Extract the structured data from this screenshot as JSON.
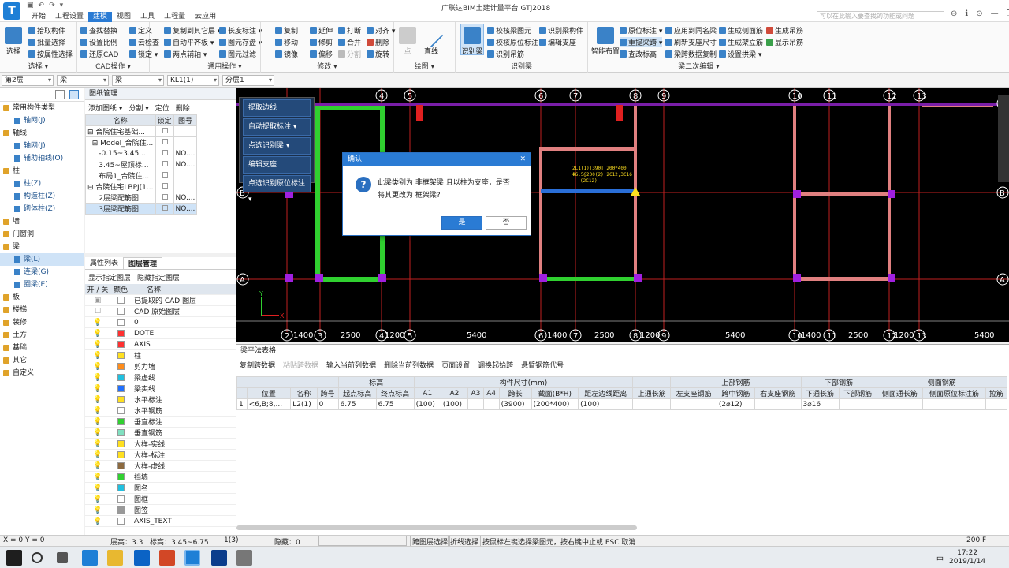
{
  "app": {
    "title": "广联达BIM土建计量平台 GTJ2018",
    "logo": "T",
    "search_placeholder": "可以在此输入要查找的功能或问题",
    "qat": [
      "▣",
      "↶",
      "↷",
      "▾"
    ],
    "win": [
      "⊖",
      "ℹ",
      "⊙",
      "—",
      "❐",
      "✕"
    ]
  },
  "menu_tabs": [
    "开始",
    "工程设置",
    "建模",
    "视图",
    "工具",
    "工程量",
    "云应用"
  ],
  "ribbon": {
    "select": {
      "title": "选择 ▾",
      "big": "选择",
      "items": [
        "拾取构件",
        "批量选择",
        "按属性选择"
      ]
    },
    "cad": {
      "title": "CAD操作 ▾",
      "items": [
        "定义",
        "云检查",
        "锁定 ▾",
        "复制到其它层 ▾",
        "自动平齐板 ▾",
        "两点辅轴 ▾",
        "查找替换",
        "设置比例",
        "还原CAD"
      ]
    },
    "general": {
      "title": "通用操作 ▾",
      "items": [
        "长度标注 ▾",
        "图元存盘 ▾",
        "图元过滤"
      ]
    },
    "modify": {
      "title": "修改 ▾",
      "items": [
        "复制",
        "移动",
        "镜像",
        "延伸",
        "修剪",
        "偏移",
        "打断",
        "合并",
        "分割",
        "对齐 ▾",
        "删除",
        "旋转"
      ]
    },
    "draw": {
      "title": "绘图 ▾",
      "items": [
        "点",
        "直线"
      ]
    },
    "recog": {
      "title": "识别梁",
      "big": "识别梁",
      "items": [
        "校核梁图元",
        "校核原位标注",
        "识别吊筋",
        "识别梁构件",
        "编辑支座"
      ]
    },
    "beam2": {
      "title": "梁二次编辑 ▾",
      "big": "智能布置",
      "items": [
        "原位标注 ▾",
        "重提梁跨 ▾",
        "查改标高",
        "应用到同名梁",
        "刷新支座尺寸",
        "梁跨数据复制",
        "生成侧面筋",
        "生成架立筋",
        "设置拱梁 ▾",
        "生成吊筋",
        "显示吊筋"
      ]
    }
  },
  "filters": [
    "第2层",
    "梁",
    "梁",
    "KL1(1)",
    "分层1"
  ],
  "leftnav": [
    {
      "label": "常用构件类型",
      "type": "cat"
    },
    {
      "label": "轴网(J)",
      "type": "sub"
    },
    {
      "label": "轴线",
      "type": "cat"
    },
    {
      "label": "轴网(J)",
      "type": "sub"
    },
    {
      "label": "辅助轴线(O)",
      "type": "sub"
    },
    {
      "label": "柱",
      "type": "cat"
    },
    {
      "label": "柱(Z)",
      "type": "sub"
    },
    {
      "label": "构造柱(Z)",
      "type": "sub"
    },
    {
      "label": "砌体柱(Z)",
      "type": "sub"
    },
    {
      "label": "墙",
      "type": "cat"
    },
    {
      "label": "门窗洞",
      "type": "cat"
    },
    {
      "label": "梁",
      "type": "cat"
    },
    {
      "label": "梁(L)",
      "type": "sub",
      "sel": true
    },
    {
      "label": "连梁(G)",
      "type": "sub"
    },
    {
      "label": "圈梁(E)",
      "type": "sub"
    },
    {
      "label": "板",
      "type": "cat"
    },
    {
      "label": "楼梯",
      "type": "cat"
    },
    {
      "label": "装修",
      "type": "cat"
    },
    {
      "label": "土方",
      "type": "cat"
    },
    {
      "label": "基础",
      "type": "cat"
    },
    {
      "label": "其它",
      "type": "cat"
    },
    {
      "label": "自定义",
      "type": "cat"
    }
  ],
  "drawing": {
    "title": "图纸管理",
    "tools": [
      "添加图纸 ▾",
      "分割 ▾",
      "定位",
      "删除"
    ],
    "headers": [
      "名称",
      "锁定",
      "图号"
    ],
    "rows": [
      [
        "⊟ 合院住宅基础...",
        "",
        ""
      ],
      [
        "  ⊟ Model_合院住...",
        "",
        ""
      ],
      [
        "     -0.15~3.45...",
        "",
        "NO...."
      ],
      [
        "     3.45~屋顶标...",
        "",
        "NO...."
      ],
      [
        "     布局1_合院住...",
        "",
        ""
      ],
      [
        "⊟ 合院住宅LBPJ(1...",
        "",
        ""
      ],
      [
        "     2层梁配筋图",
        "",
        "NO...."
      ],
      [
        "     3层梁配筋图",
        "",
        "NO...."
      ]
    ]
  },
  "layers": {
    "tabs": [
      "属性列表",
      "图层管理"
    ],
    "tools": [
      "显示指定图层",
      "隐藏指定图层"
    ],
    "headers": [
      "开 / 关",
      "颜色",
      "名称"
    ],
    "rows": [
      {
        "name": "已提取的 CAD 图层",
        "color": "#ffffff",
        "on": "▣"
      },
      {
        "name": "CAD 原始图层",
        "color": "#ffffff",
        "on": "☐"
      },
      {
        "name": "0",
        "color": "#ffffff",
        "on": "💡"
      },
      {
        "name": "DOTE",
        "color": "#ff3030",
        "on": "💡"
      },
      {
        "name": "AXIS",
        "color": "#ff3030",
        "on": "💡"
      },
      {
        "name": "柱",
        "color": "#ffe020",
        "on": "💡"
      },
      {
        "name": "剪力墙",
        "color": "#ff8c1a",
        "on": "💡"
      },
      {
        "name": "梁虚线",
        "color": "#20c0e0",
        "on": "💡"
      },
      {
        "name": "梁实线",
        "color": "#2070ff",
        "on": "💡"
      },
      {
        "name": "水平标注",
        "color": "#ffe020",
        "on": "💡"
      },
      {
        "name": "水平钢筋",
        "color": "#ffffff",
        "on": "💡"
      },
      {
        "name": "垂直标注",
        "color": "#30d030",
        "on": "💡"
      },
      {
        "name": "垂直钢筋",
        "color": "#80e0c0",
        "on": "💡"
      },
      {
        "name": "大样-实线",
        "color": "#ffe020",
        "on": "💡"
      },
      {
        "name": "大样-标注",
        "color": "#ffe020",
        "on": "💡"
      },
      {
        "name": "大样-虚线",
        "color": "#8c6a40",
        "on": "💡"
      },
      {
        "name": "挡墙",
        "color": "#30d030",
        "on": "💡"
      },
      {
        "name": "图名",
        "color": "#20c0e0",
        "on": "💡"
      },
      {
        "name": "图框",
        "color": "#ffffff",
        "on": "💡"
      },
      {
        "name": "图签",
        "color": "#999999",
        "on": "💡"
      },
      {
        "name": "AXIS_TEXT",
        "color": "#ffffff",
        "on": "💡"
      }
    ]
  },
  "canvas": {
    "menu": [
      "提取边线",
      "自动提取标注 ▾",
      "点选识别梁 ▾",
      "编辑支座",
      "点选识别原位标注 ▾"
    ],
    "axes_bottom": [
      "2",
      "3",
      "4",
      "5",
      "6",
      "7",
      "8",
      "9",
      "10",
      "11",
      "12",
      "13"
    ],
    "axes_top": [
      "4",
      "5",
      "6",
      "7",
      "8",
      "9",
      "10",
      "11",
      "12",
      "13"
    ],
    "axes_right": [
      "C",
      "B",
      "A"
    ],
    "axes_left": [
      "B",
      "A"
    ],
    "dims": [
      "1400",
      "2500",
      "1200",
      "5400",
      "1400",
      "2500",
      "1200",
      "5400",
      "1400",
      "2500",
      "1200",
      "5400"
    ],
    "beam_label": [
      "2L1(1)[390] 200*400",
      "Φ6.5@200(2) 2C12;3C16",
      "(2C12)"
    ],
    "ucs": [
      "Y",
      "X"
    ]
  },
  "dialog": {
    "title": "确认",
    "message_line1": "此梁类别为 非框架梁 且以柱为支座，是否",
    "message_line2": "将其更改为 框架梁?",
    "yes": "是",
    "no": "否",
    "icon": "?",
    "close": "✕"
  },
  "beam_table": {
    "title": "梁平法表格",
    "tools": [
      "复制跨数据",
      "粘贴跨数据",
      "输入当前列数据",
      "删除当前列数据",
      "页面设置",
      "调换起始跨",
      "悬臂钢筋代号"
    ],
    "group_headers": [
      "标高",
      "构件尺寸(mm)",
      "上部钢筋",
      "下部钢筋",
      "侧面钢筋"
    ],
    "headers": [
      "位置",
      "名称",
      "跨号",
      "起点标高",
      "终点标高",
      "A1",
      "A2",
      "A3",
      "A4",
      "跨长",
      "截面(B*H)",
      "距左边线距离",
      "上通长筋",
      "左支座钢筋",
      "跨中钢筋",
      "右支座钢筋",
      "下通长筋",
      "下部钢筋",
      "侧面通长筋",
      "侧面原位标注筋",
      "拉筋"
    ],
    "row": [
      "<6,B;8,...",
      "L2(1)",
      "0",
      "6.75",
      "6.75",
      "(100)",
      "(100)",
      "",
      "",
      "(3900)",
      "(200*400)",
      "(100)",
      "",
      "",
      "(2⌀12)",
      "",
      "3⌀16",
      "",
      "",
      "",
      ""
    ],
    "rownum": "1"
  },
  "status": {
    "coord": "X = 0 Y = 0",
    "floor_h": "层高：3.3",
    "elev": "标高：3.45~6.75",
    "count": "1(3)",
    "hidden": "隐藏：0",
    "b1": "跨图层选择",
    "b2": "折线选择",
    "hint": "按鼠标左键选择梁图元，按右键中止或 ESC 取消",
    "zoom": "200 F"
  },
  "taskbar": {
    "time": "17:22",
    "date": "2019/1/14",
    "lang": "中"
  }
}
